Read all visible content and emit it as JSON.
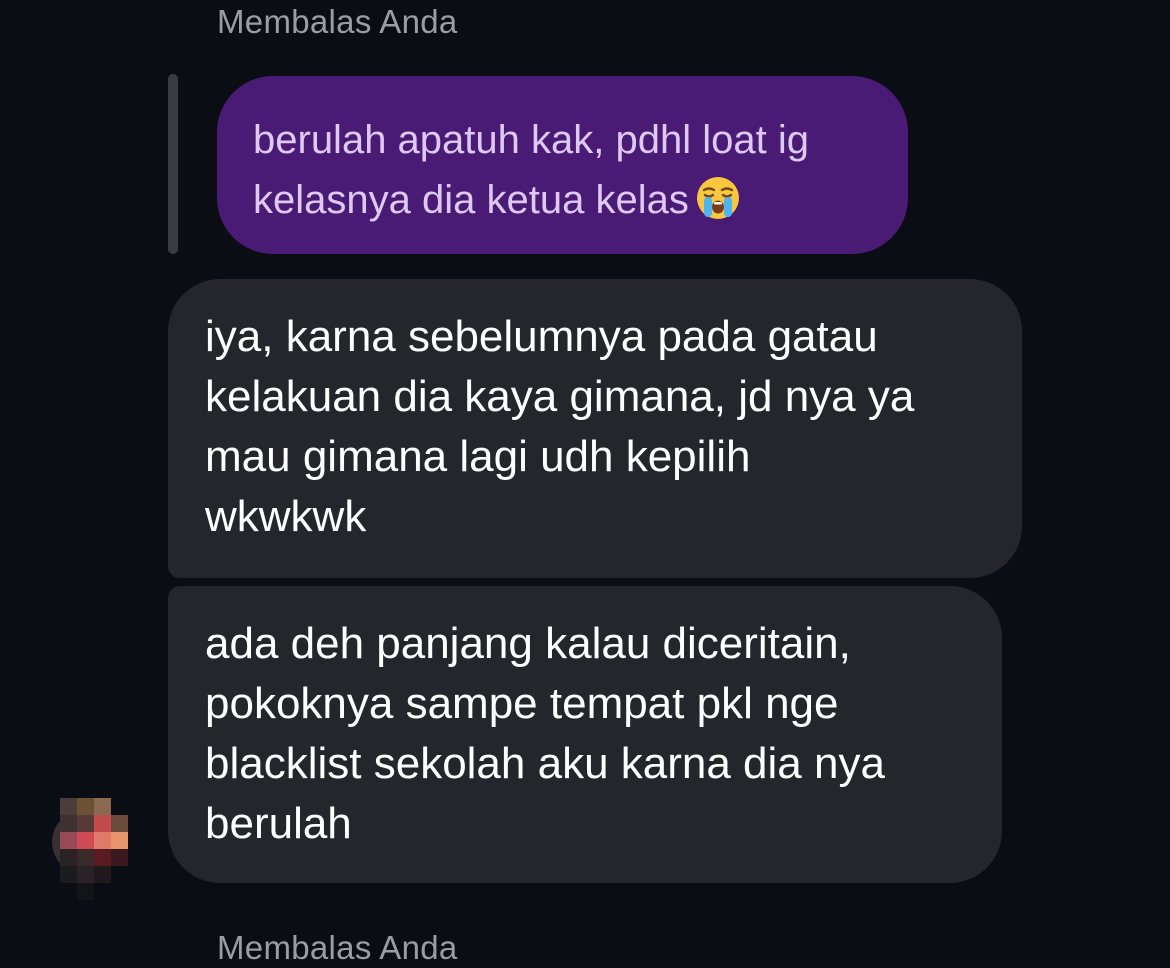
{
  "thread": {
    "reply_label_top": "Membalas Anda",
    "reply_label_bottom": "Membalas Anda",
    "quoted_message": {
      "lines": [
        "berulah apatuh kak, pdhl loat ig",
        "kelasnya dia ketua kelas"
      ],
      "emoji": "loudly-crying-face-icon"
    },
    "messages": [
      {
        "lines": [
          "iya, karna sebelumnya pada gatau",
          "kelakuan dia kaya gimana, jd nya ya",
          "mau gimana lagi udh kepilih",
          "wkwkwk"
        ]
      },
      {
        "lines": [
          "ada deh panjang kalau diceritain,",
          "pokoknya sampe tempat pkl nge",
          "blacklist sekolah aku karna dia nya",
          "berulah"
        ]
      }
    ]
  },
  "colors": {
    "background": "#0b0d14",
    "quoted_bubble": "#4a1b75",
    "quoted_text": "#ddc9f2",
    "incoming_bubble": "#24262c",
    "incoming_text": "#ffffff",
    "reply_label": "#9a9ca6"
  }
}
